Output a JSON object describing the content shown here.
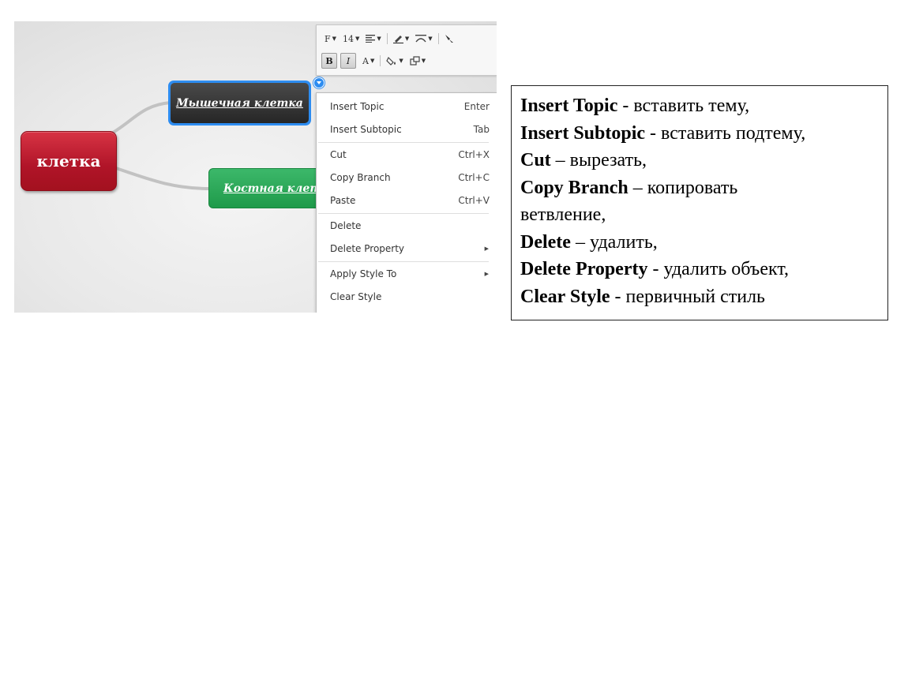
{
  "mindmap": {
    "central_topic": "клетка",
    "subtopics": [
      "Мышечная клетка",
      "Костная клетка"
    ]
  },
  "toolbar": {
    "font_label": "F",
    "size_label": "14",
    "bold_label": "B",
    "italic_label": "I",
    "font_color_label": "A"
  },
  "context_menu": {
    "items": [
      {
        "label": "Insert Topic",
        "shortcut": "Enter"
      },
      {
        "label": "Insert Subtopic",
        "shortcut": "Tab"
      },
      {
        "label": "Cut",
        "shortcut": "Ctrl+X"
      },
      {
        "label": "Copy Branch",
        "shortcut": "Ctrl+C"
      },
      {
        "label": "Paste",
        "shortcut": "Ctrl+V"
      },
      {
        "label": "Delete",
        "shortcut": ""
      },
      {
        "label": "Delete Property",
        "shortcut": ""
      },
      {
        "label": "Apply Style To",
        "shortcut": ""
      },
      {
        "label": "Clear Style",
        "shortcut": ""
      }
    ]
  },
  "description": [
    {
      "term": "Insert Topic",
      "text": " - вставить тему,"
    },
    {
      "term": "Insert Subtopic",
      "text": " - вставить подтему,"
    },
    {
      "term": "Cut",
      "text": " – вырезать,"
    },
    {
      "term": "Copy Branch",
      "text": " – копировать"
    },
    {
      "term": "",
      "text": "ветвление,"
    },
    {
      "term": "Delete",
      "text": " – удалить,"
    },
    {
      "term": "Delete Property",
      "text": " - удалить объект,"
    },
    {
      "term": "Clear Style",
      "text": " - первичный стиль"
    }
  ]
}
